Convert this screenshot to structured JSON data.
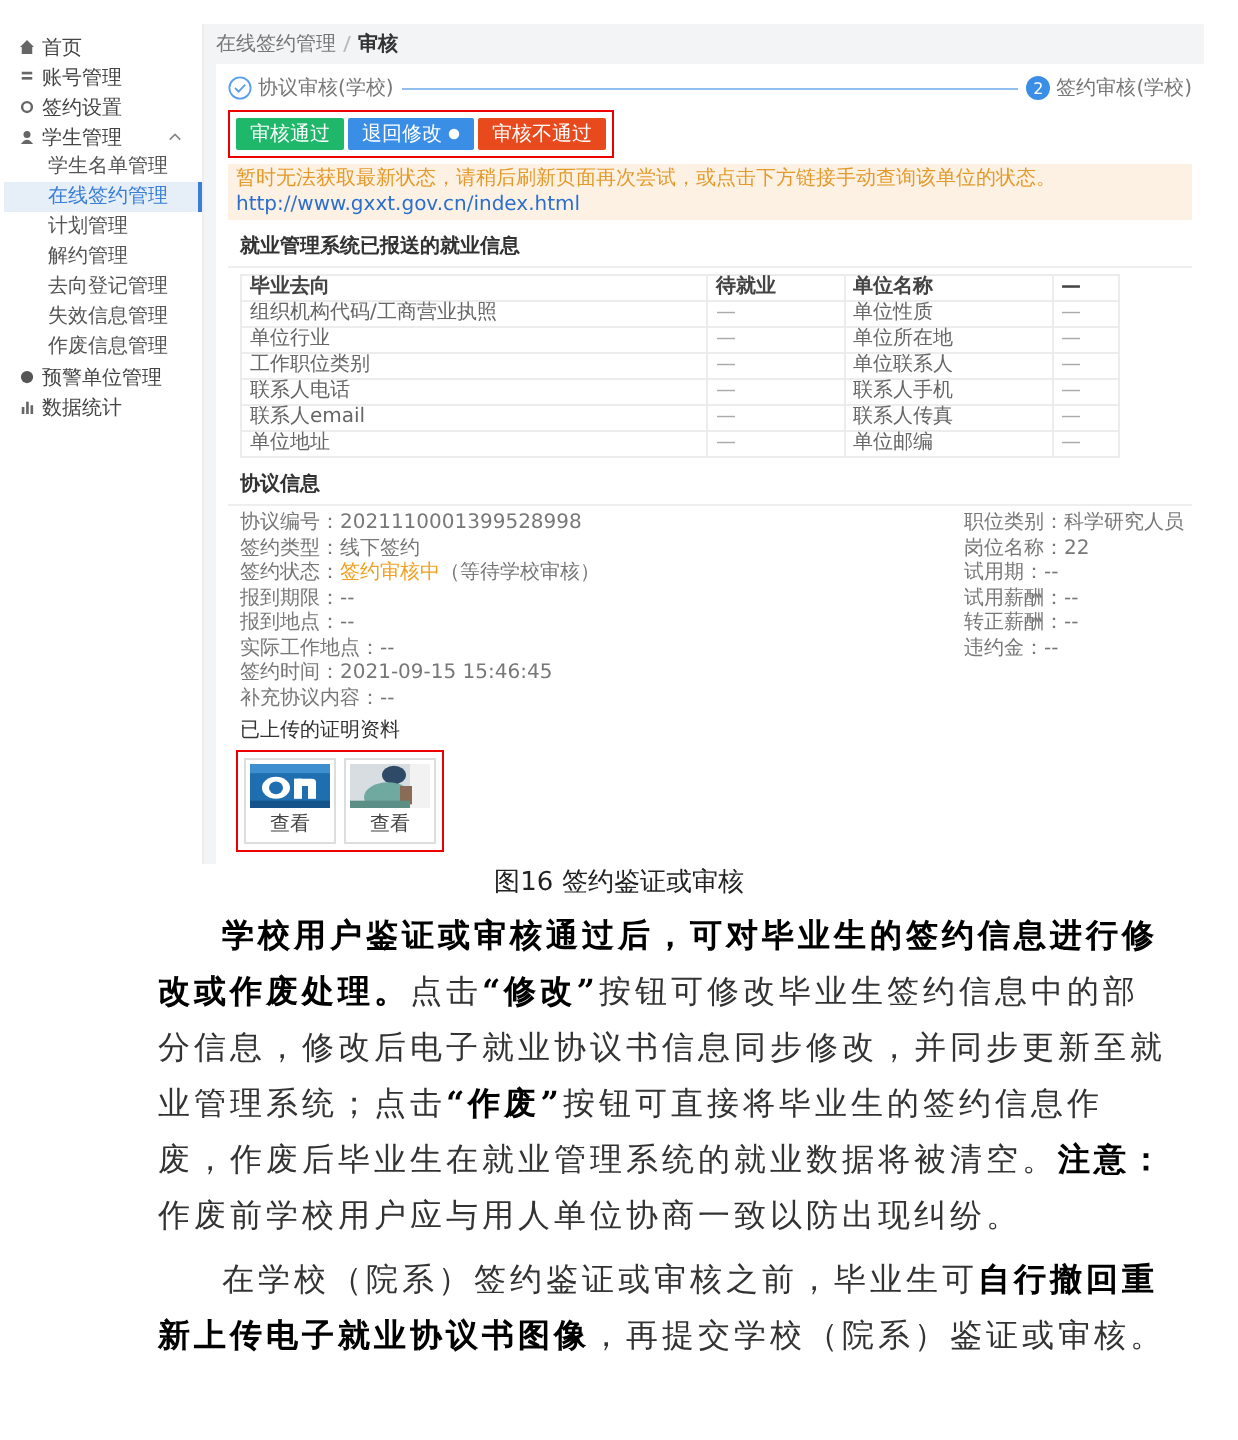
{
  "screenshot": {
    "sidebar": {
      "items": [
        {
          "label": "首页",
          "selected": false
        },
        {
          "label": "账号管理",
          "selected": false
        },
        {
          "label": "签约设置",
          "selected": false
        },
        {
          "label": "学生管理",
          "selected": false,
          "expanded": true,
          "children": [
            {
              "label": "学生名单管理",
              "selected": false
            },
            {
              "label": "在线签约管理",
              "selected": true
            },
            {
              "label": "计划管理",
              "selected": false
            },
            {
              "label": "解约管理",
              "selected": false
            },
            {
              "label": "去向登记管理",
              "selected": false
            },
            {
              "label": "失效信息管理",
              "selected": false
            },
            {
              "label": "作废信息管理",
              "selected": false
            }
          ]
        },
        {
          "label": "预警单位管理",
          "selected": false
        },
        {
          "label": "数据统计",
          "selected": false
        }
      ]
    },
    "breadcrumb": [
      "在线签约管理",
      "审核"
    ],
    "steps": [
      {
        "label": "协议审核(学校)",
        "done": true
      },
      {
        "label": "签约审核(学校)",
        "number": "2",
        "done": false
      }
    ],
    "buttons": [
      {
        "label": "审核通过",
        "kind": "success",
        "has_icon": false
      },
      {
        "label": "退回修改",
        "kind": "primary",
        "has_icon": true
      },
      {
        "label": "审核不通过",
        "kind": "danger",
        "has_icon": false
      }
    ],
    "notice": {
      "text": "暂时无法获取最新状态，请稍后刷新页面再次尝试，或点击下方链接手动查询该单位的状态。",
      "link": "http://www.gxxt.gov.cn/index.html"
    },
    "employment_info": {
      "title": "就业管理系统已报送的就业信息",
      "columns": [
        "毕业去向",
        "待就业",
        "单位名称",
        "—"
      ],
      "rows": [
        [
          "组织机构代码/工商营业执照",
          "—",
          "单位性质",
          "—"
        ],
        [
          "单位行业",
          "—",
          "单位所在地",
          "—"
        ],
        [
          "工作职位类别",
          "—",
          "单位联系人",
          "—"
        ],
        [
          "联系人电话",
          "—",
          "联系人手机",
          "—"
        ],
        [
          "联系人email",
          "—",
          "联系人传真",
          "—"
        ],
        [
          "单位地址",
          "—",
          "单位邮编",
          "—"
        ]
      ]
    },
    "agreement_info": {
      "title": "协议信息",
      "left": [
        {
          "kind": "text",
          "text": "协议编号：2021110001399528998"
        },
        {
          "kind": "text",
          "text": "签约类型：线下签约"
        },
        {
          "kind": "status",
          "label": "签约状态：",
          "value": "签约审核中",
          "note": "（等待学校审核）"
        },
        {
          "kind": "text",
          "text": "报到期限：--"
        },
        {
          "kind": "text",
          "text": "报到地点：--"
        },
        {
          "kind": "text",
          "text": "实际工作地点：--"
        },
        {
          "kind": "text",
          "text": "签约时间：2021-09-15 15:46:45"
        },
        {
          "kind": "text",
          "text": "补充协议内容：--"
        }
      ],
      "right": [
        {
          "kind": "text",
          "text": "职位类别：科学研究人员"
        },
        {
          "kind": "text",
          "text": "岗位名称：22"
        },
        {
          "kind": "text",
          "text": "试用期：--"
        },
        {
          "kind": "text",
          "text": "试用薪酬：--"
        },
        {
          "kind": "text",
          "text": "转正薪酬：--"
        },
        {
          "kind": "text",
          "text": "违约金：--"
        }
      ]
    },
    "attachments": {
      "title": "已上传的证明资料",
      "items": [
        {
          "kind": "picture",
          "label": "查看"
        },
        {
          "kind": "picture",
          "label": "查看"
        }
      ]
    }
  },
  "caption": "图16 签约鉴证或审核",
  "paragraphs": [
    "**学校用户鉴证或审核通过后，可对毕业生的签约信息进行修改或作废处理。**点击**“修改”**按钮可修改毕业生签约信息中的部分信息，修改后电子就业协议书信息同步修改，并同步更新至就业管理系统；点击**“作废”**按钮可直接将毕业生的签约信息作废，作废后毕业生在就业管理系统的就业数据将被清空。**注意：**作废前学校用户应与用人单位协商一致以防出现纠纷。",
    "在学校（院系）签约鉴证或审核之前，毕业生可**自行撤回重新上传电子就业协议书图像**，再提交学校（院系）鉴证或审核。"
  ]
}
